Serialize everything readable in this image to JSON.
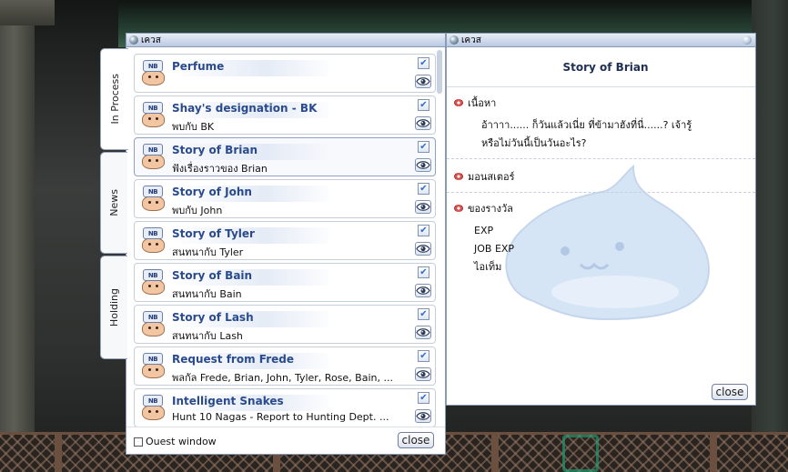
{
  "list_window": {
    "title": "เควส",
    "tabs": [
      {
        "label": "In Process",
        "active": true
      },
      {
        "label": "News",
        "active": false
      },
      {
        "label": "Holding",
        "active": false
      }
    ],
    "quests": [
      {
        "badge": "NB",
        "title": "Perfume",
        "subtitle": "",
        "checked": true,
        "selected": false
      },
      {
        "badge": "NB",
        "title": "Shay's designation - BK",
        "subtitle": "พบกับ BK",
        "checked": true,
        "selected": false
      },
      {
        "badge": "NB",
        "title": "Story of Brian",
        "subtitle": "ฟังเรื่องราวของ Brian",
        "checked": true,
        "selected": true
      },
      {
        "badge": "NB",
        "title": "Story of John",
        "subtitle": "พบกับ John",
        "checked": true,
        "selected": false
      },
      {
        "badge": "NB",
        "title": "Story of Tyler",
        "subtitle": "สนทนากับ Tyler",
        "checked": true,
        "selected": false
      },
      {
        "badge": "NB",
        "title": "Story of Bain",
        "subtitle": "สนทนากับ Bain",
        "checked": true,
        "selected": false
      },
      {
        "badge": "NB",
        "title": "Story of Lash",
        "subtitle": "สนทนากับ Lash",
        "checked": true,
        "selected": false
      },
      {
        "badge": "NB",
        "title": "Request from Frede",
        "subtitle": "พลกัล Frede, Brian, John, Tyler, Rose, Bain, ...",
        "checked": true,
        "selected": false
      },
      {
        "badge": "NB",
        "title": "Intelligent Snakes",
        "subtitle": "Hunt 10 Nagas - Report to Hunting Dept. ...",
        "checked": true,
        "selected": false
      }
    ],
    "quest_window_label": "Ouest window",
    "quest_window_checked": false,
    "close_label": "close"
  },
  "detail_window": {
    "title": "เควส",
    "quest_title": "Story of Brian",
    "content_heading": "เนื้อหา",
    "content_text": "อ้าาาา...... ก็วันแล้วเนี่ย ที่ข้ามาฮังที่นี่......? เจ้ารู้หรือไม่วันนี้เป็นวันอะไร?",
    "monster_heading": "มอนสเตอร์",
    "reward_heading": "ของรางวัล",
    "rewards": [
      "EXP",
      "JOB EXP",
      "ไอเท็ม"
    ],
    "close_label": "close"
  },
  "colors": {
    "title_blue": "#2a4a8e",
    "check_blue": "#2f6bd6",
    "window_border": "#8a9bb8"
  },
  "icons": {
    "quest_badge": "novice-face-icon",
    "view": "eye-icon",
    "check": "checkmark-icon",
    "section": "red-orb-icon"
  }
}
